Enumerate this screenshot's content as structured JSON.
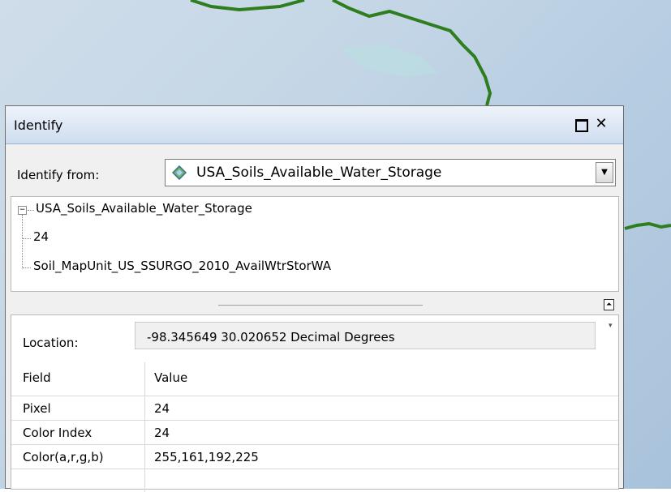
{
  "window": {
    "title": "Identify",
    "maximize_icon": "maximize-icon",
    "close_glyph": "✕"
  },
  "identify_from": {
    "label": "Identify from:",
    "selected_layer": "USA_Soils_Available_Water_Storage",
    "layer_icon": "raster-layer-icon"
  },
  "tree": {
    "root_label": "USA_Soils_Available_Water_Storage",
    "collapse_glyph": "−",
    "children": [
      "24",
      "Soil_MapUnit_US_SSURGO_2010_AvailWtrStorWA"
    ]
  },
  "location": {
    "label": "Location:",
    "value": "-98.345649  30.020652 Decimal Degrees"
  },
  "attributes": {
    "headers": [
      "Field",
      "Value"
    ],
    "rows": [
      {
        "field": "Pixel",
        "value": "24"
      },
      {
        "field": "Color Index",
        "value": "24"
      },
      {
        "field": "Color(a,r,g,b)",
        "value": "255,161,192,225"
      }
    ]
  },
  "colors": {
    "river": "#2e7d1e",
    "titlebar": "#dbe6f4",
    "map_water": "#c4d6e6"
  }
}
